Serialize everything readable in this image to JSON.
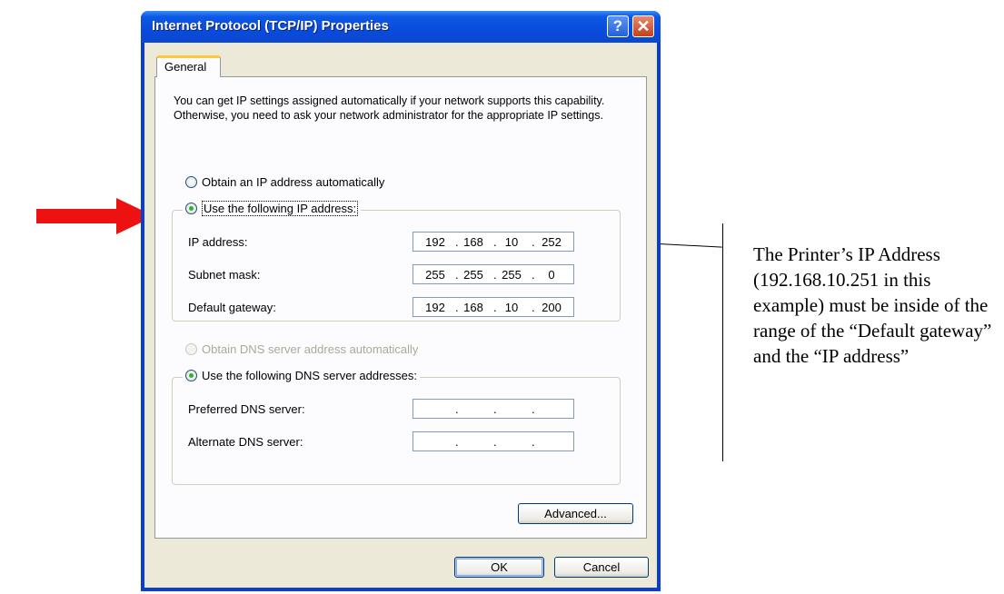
{
  "window": {
    "title": "Internet Protocol (TCP/IP) Properties",
    "help_glyph": "?",
    "close_glyph": "✕"
  },
  "tabs": [
    "General"
  ],
  "description": "You can get IP settings assigned automatically if your network supports this capability. Otherwise, you need to ask your network administrator for the appropriate IP settings.",
  "ip_options": {
    "auto_label": "Obtain an IP address automatically",
    "manual_label": "Use the following IP address:",
    "selected": "manual"
  },
  "ip_fields": [
    {
      "label": "IP address:",
      "octets": [
        "192",
        "168",
        "10",
        "252"
      ]
    },
    {
      "label": "Subnet mask:",
      "octets": [
        "255",
        "255",
        "255",
        "0"
      ]
    },
    {
      "label": "Default gateway:",
      "octets": [
        "192",
        "168",
        "10",
        "200"
      ]
    }
  ],
  "dns_options": {
    "auto_label": "Obtain DNS server address automatically",
    "auto_enabled": false,
    "manual_label": "Use the following DNS server addresses:",
    "selected": "manual"
  },
  "dns_fields": [
    {
      "label": "Preferred DNS server:",
      "octets": [
        "",
        "",
        "",
        ""
      ]
    },
    {
      "label": "Alternate DNS server:",
      "octets": [
        "",
        "",
        "",
        ""
      ]
    }
  ],
  "buttons": {
    "advanced": "Advanced...",
    "ok": "OK",
    "cancel": "Cancel"
  },
  "annotation": {
    "text": "The Printer’s IP Address (192.168.10.251 in this example) must be inside of the range of the “Default gateway” and the “IP address”",
    "arrow_color": "#ee1111"
  }
}
